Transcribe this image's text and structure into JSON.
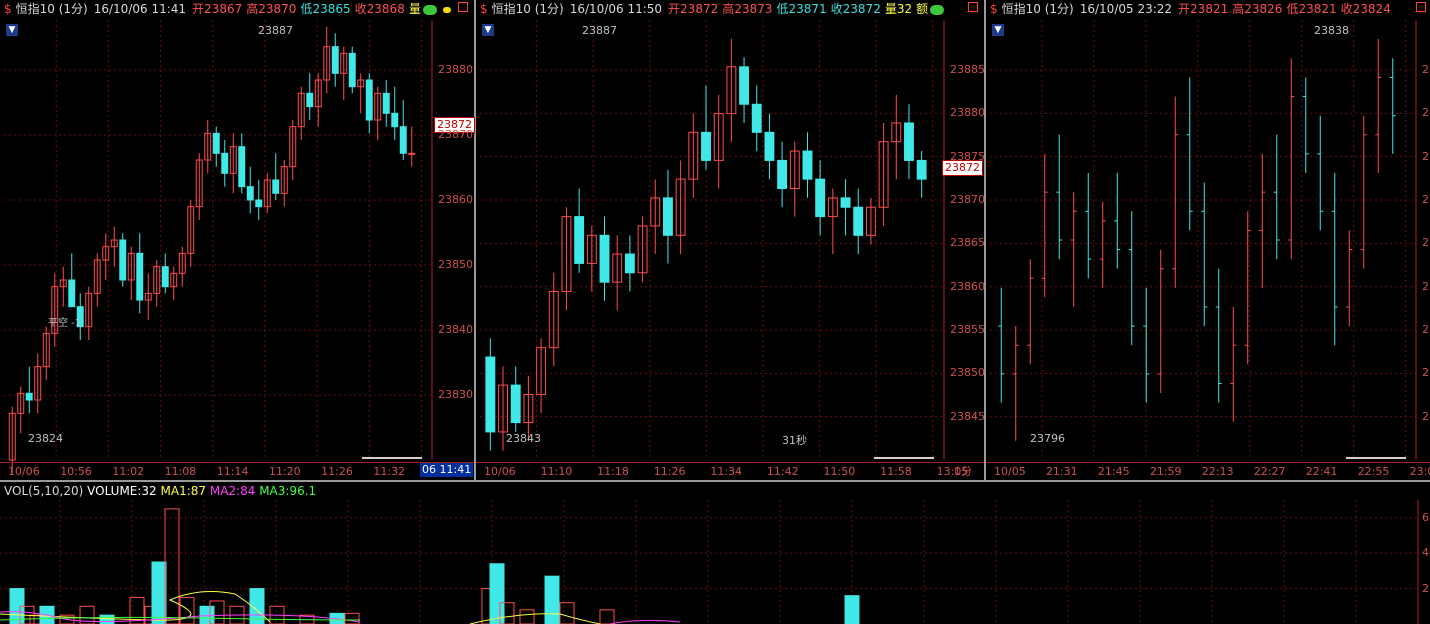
{
  "panels": [
    {
      "name": "恒指10 (1分)",
      "datetime": "16/10/06 11:41",
      "open_label": "开",
      "open": "23867",
      "high_label": "高",
      "high": "23870",
      "low_label": "低",
      "low": "23865",
      "close_label": "收",
      "close": "23868",
      "volume_label": "量",
      "high_marker": "23887",
      "low_marker": "23824",
      "trade_marker": "平空 -1",
      "current_price": "23872",
      "current_time": "06 11:41",
      "y_ticks": [
        "23880",
        "23870",
        "23860",
        "23850",
        "23840",
        "23830"
      ],
      "x_ticks": [
        "10/06",
        "10:56",
        "11:02",
        "11:08",
        "11:14",
        "11:20",
        "11:26",
        "11:32",
        "11:3"
      ]
    },
    {
      "name": "恒指10 (1分)",
      "datetime": "16/10/06 11:50",
      "open_label": "开",
      "open": "23872",
      "high_label": "高",
      "high": "23873",
      "low_label": "低",
      "low": "23871",
      "close_label": "收",
      "close": "23872",
      "volume_label": "量",
      "volume": "32",
      "amount_label": "额",
      "high_marker": "23887",
      "low_marker": "23843",
      "countdown": "31秒",
      "current_price": "23872",
      "y_ticks": [
        "23885",
        "23880",
        "23875",
        "23870",
        "23865",
        "23860",
        "23855",
        "23850",
        "23845"
      ],
      "x_ticks": [
        "10/06",
        "11:10",
        "11:18",
        "11:26",
        "11:34",
        "11:42",
        "11:50",
        "11:58",
        "13:05"
      ],
      "period": "1分"
    },
    {
      "name": "恒指10 (1分)",
      "datetime": "16/10/05 23:22",
      "open_label": "开",
      "open": "23821",
      "high_label": "高",
      "high": "23826",
      "low_label": "低",
      "low": "23821",
      "close_label": "收",
      "close": "23824",
      "high_marker": "23838",
      "low_marker": "23796",
      "y_ticks": [
        "2",
        "2",
        "2",
        "2",
        "2",
        "2",
        "2",
        "2",
        "2"
      ],
      "x_ticks": [
        "10/05",
        "21:31",
        "21:45",
        "21:59",
        "22:13",
        "22:27",
        "22:41",
        "22:55",
        "23:09"
      ]
    }
  ],
  "volume": {
    "title": "VOL(5,10,20)",
    "volume": "VOLUME:32",
    "ma1": "MA1:87",
    "ma2": "MA2:84",
    "ma3": "MA3:96.1",
    "y_ticks": [
      "6",
      "4",
      "2"
    ]
  },
  "colors": {
    "up": "#ff4d4d",
    "down": "#40e8e8",
    "grid": "#6a1010",
    "axis": "#b02020",
    "ma1": "#ffff40",
    "ma2": "#ff40ff",
    "ma3": "#40ff40"
  },
  "chart_data": [
    {
      "type": "candlestick",
      "title": "恒指10 (1分) 16/10/06 11:41",
      "ylim": [
        23822,
        23888
      ],
      "x_ticks": [
        "10/06",
        "10:56",
        "11:02",
        "11:08",
        "11:14",
        "11:20",
        "11:26",
        "11:32",
        "11:3"
      ],
      "ohlc": [
        [
          23822,
          23830,
          23820,
          23829
        ],
        [
          23829,
          23833,
          23826,
          23832
        ],
        [
          23832,
          23836,
          23829,
          23831
        ],
        [
          23831,
          23838,
          23829,
          23836
        ],
        [
          23836,
          23842,
          23834,
          23841
        ],
        [
          23841,
          23850,
          23839,
          23848
        ],
        [
          23848,
          23851,
          23845,
          23849
        ],
        [
          23849,
          23853,
          23846,
          23845
        ],
        [
          23845,
          23847,
          23840,
          23842
        ],
        [
          23842,
          23848,
          23840,
          23847
        ],
        [
          23847,
          23853,
          23845,
          23852
        ],
        [
          23852,
          23856,
          23849,
          23854
        ],
        [
          23854,
          23857,
          23851,
          23855
        ],
        [
          23855,
          23856,
          23848,
          23849
        ],
        [
          23849,
          23854,
          23846,
          23853
        ],
        [
          23853,
          23856,
          23844,
          23846
        ],
        [
          23846,
          23850,
          23843,
          23847
        ],
        [
          23847,
          23852,
          23845,
          23851
        ],
        [
          23851,
          23853,
          23847,
          23848
        ],
        [
          23848,
          23851,
          23846,
          23850
        ],
        [
          23850,
          23854,
          23848,
          23853
        ],
        [
          23853,
          23861,
          23851,
          23860
        ],
        [
          23860,
          23868,
          23858,
          23867
        ],
        [
          23867,
          23873,
          23865,
          23871
        ],
        [
          23871,
          23872,
          23866,
          23868
        ],
        [
          23868,
          23870,
          23863,
          23865
        ],
        [
          23865,
          23871,
          23862,
          23869
        ],
        [
          23869,
          23871,
          23862,
          23863
        ],
        [
          23863,
          23866,
          23859,
          23861
        ],
        [
          23861,
          23864,
          23858,
          23860
        ],
        [
          23860,
          23865,
          23859,
          23864
        ],
        [
          23864,
          23868,
          23861,
          23862
        ],
        [
          23862,
          23867,
          23860,
          23866
        ],
        [
          23866,
          23873,
          23864,
          23872
        ],
        [
          23872,
          23878,
          23870,
          23877
        ],
        [
          23877,
          23880,
          23873,
          23875
        ],
        [
          23875,
          23880,
          23872,
          23879
        ],
        [
          23879,
          23887,
          23877,
          23884
        ],
        [
          23884,
          23886,
          23878,
          23880
        ],
        [
          23880,
          23884,
          23876,
          23883
        ],
        [
          23883,
          23884,
          23877,
          23878
        ],
        [
          23878,
          23880,
          23874,
          23879
        ],
        [
          23879,
          23880,
          23871,
          23873
        ],
        [
          23873,
          23878,
          23870,
          23877
        ],
        [
          23877,
          23879,
          23872,
          23874
        ],
        [
          23874,
          23878,
          23870,
          23872
        ],
        [
          23872,
          23876,
          23867,
          23868
        ],
        [
          23868,
          23872,
          23866,
          23868
        ]
      ]
    },
    {
      "type": "candlestick",
      "title": "恒指10 (1分) 16/10/06 11:50",
      "ylim": [
        23842,
        23889
      ],
      "x_ticks": [
        "10/06",
        "11:10",
        "11:18",
        "11:26",
        "11:34",
        "11:42",
        "11:50",
        "11:58",
        "13:05"
      ],
      "ohlc": [
        [
          23853,
          23855,
          23843,
          23845
        ],
        [
          23845,
          23852,
          23843,
          23850
        ],
        [
          23850,
          23852,
          23845,
          23846
        ],
        [
          23846,
          23851,
          23844,
          23849
        ],
        [
          23849,
          23855,
          23847,
          23854
        ],
        [
          23854,
          23862,
          23852,
          23860
        ],
        [
          23860,
          23869,
          23858,
          23868
        ],
        [
          23868,
          23871,
          23862,
          23863
        ],
        [
          23863,
          23867,
          23860,
          23866
        ],
        [
          23866,
          23868,
          23859,
          23861
        ],
        [
          23861,
          23866,
          23858,
          23864
        ],
        [
          23864,
          23866,
          23860,
          23862
        ],
        [
          23862,
          23868,
          23861,
          23867
        ],
        [
          23867,
          23872,
          23864,
          23870
        ],
        [
          23870,
          23873,
          23863,
          23866
        ],
        [
          23866,
          23874,
          23864,
          23872
        ],
        [
          23872,
          23879,
          23870,
          23877
        ],
        [
          23877,
          23882,
          23873,
          23874
        ],
        [
          23874,
          23881,
          23871,
          23879
        ],
        [
          23879,
          23887,
          23876,
          23884
        ],
        [
          23884,
          23885,
          23878,
          23880
        ],
        [
          23880,
          23882,
          23875,
          23877
        ],
        [
          23877,
          23879,
          23872,
          23874
        ],
        [
          23874,
          23876,
          23869,
          23871
        ],
        [
          23871,
          23876,
          23868,
          23875
        ],
        [
          23875,
          23877,
          23870,
          23872
        ],
        [
          23872,
          23874,
          23866,
          23868
        ],
        [
          23868,
          23871,
          23864,
          23870
        ],
        [
          23870,
          23872,
          23866,
          23869
        ],
        [
          23869,
          23871,
          23864,
          23866
        ],
        [
          23866,
          23870,
          23865,
          23869
        ],
        [
          23869,
          23878,
          23867,
          23876
        ],
        [
          23876,
          23881,
          23872,
          23878
        ],
        [
          23878,
          23880,
          23872,
          23874
        ],
        [
          23874,
          23875,
          23870,
          23872
        ]
      ]
    },
    {
      "type": "candlestick",
      "title": "恒指10 (1分) 16/10/05 23:22",
      "ylim": [
        23794,
        23840
      ],
      "x_ticks": [
        "10/05",
        "21:31",
        "21:45",
        "21:59",
        "22:13",
        "22:27",
        "22:41",
        "22:55",
        "23:09"
      ],
      "ohlc": [
        [
          23808,
          23812,
          23800,
          23803
        ],
        [
          23803,
          23808,
          23796,
          23806
        ],
        [
          23806,
          23815,
          23804,
          23813
        ],
        [
          23813,
          23826,
          23811,
          23822
        ],
        [
          23822,
          23828,
          23815,
          23817
        ],
        [
          23817,
          23822,
          23810,
          23820
        ],
        [
          23820,
          23824,
          23813,
          23815
        ],
        [
          23815,
          23821,
          23812,
          23819
        ],
        [
          23819,
          23824,
          23814,
          23816
        ],
        [
          23816,
          23820,
          23806,
          23808
        ],
        [
          23808,
          23812,
          23800,
          23803
        ],
        [
          23803,
          23816,
          23801,
          23814
        ],
        [
          23814,
          23832,
          23812,
          23828
        ],
        [
          23828,
          23834,
          23818,
          23820
        ],
        [
          23820,
          23823,
          23808,
          23810
        ],
        [
          23810,
          23814,
          23800,
          23802
        ],
        [
          23802,
          23810,
          23798,
          23806
        ],
        [
          23806,
          23820,
          23804,
          23818
        ],
        [
          23818,
          23826,
          23812,
          23822
        ],
        [
          23822,
          23828,
          23815,
          23817
        ],
        [
          23817,
          23836,
          23815,
          23832
        ],
        [
          23832,
          23834,
          23824,
          23826
        ],
        [
          23826,
          23830,
          23818,
          23820
        ],
        [
          23820,
          23824,
          23806,
          23810
        ],
        [
          23810,
          23818,
          23808,
          23816
        ],
        [
          23816,
          23830,
          23814,
          23828
        ],
        [
          23828,
          23838,
          23824,
          23834
        ],
        [
          23834,
          23836,
          23826,
          23830
        ]
      ]
    },
    {
      "type": "bar",
      "title": "VOL(5,10,20)",
      "series": [
        {
          "name": "VOLUME",
          "values": [
            2,
            1,
            0.5,
            1,
            0.5,
            1,
            0.5,
            1.5,
            1,
            3.5,
            6.5,
            1.5,
            1,
            1.3,
            1,
            2,
            1,
            0.5,
            0.6,
            0.6,
            2,
            3.4,
            1.2,
            0.8,
            2.7,
            1.2,
            0.8,
            1.6
          ]
        }
      ]
    }
  ]
}
